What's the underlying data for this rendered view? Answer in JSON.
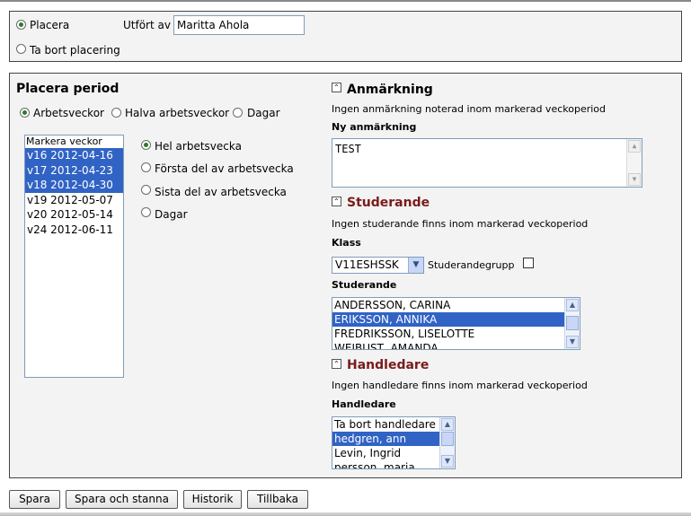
{
  "top": {
    "place_label": "Placera",
    "remove_label": "Ta bort placering",
    "performed_by_label": "Utfört av",
    "performed_by_value": "Maritta Ahola"
  },
  "period": {
    "title": "Placera period",
    "mode_options": [
      "Arbetsveckor",
      "Halva arbetsveckor",
      "Dagar"
    ],
    "mode_selected": "Arbetsveckor",
    "mark_weeks_label": "Markera veckor",
    "weeks": [
      {
        "label": "v16 2012-04-16",
        "selected": true
      },
      {
        "label": "v17 2012-04-23",
        "selected": true
      },
      {
        "label": "v18 2012-04-30",
        "selected": true
      },
      {
        "label": "v19 2012-05-07",
        "selected": false
      },
      {
        "label": "v20 2012-05-14",
        "selected": false
      },
      {
        "label": "v24 2012-06-11",
        "selected": false
      }
    ],
    "part_options": [
      "Hel arbetsvecka",
      "Första del av arbetsvecka",
      "Sista del av arbetsvecka",
      "Dagar"
    ],
    "part_selected": "Hel arbetsvecka"
  },
  "remark": {
    "title": "Anmärkning",
    "info": "Ingen anmärkning noterad inom markerad veckoperiod",
    "new_label": "Ny anmärkning",
    "new_value": "TEST"
  },
  "students": {
    "title": "Studerande",
    "info": "Ingen studerande finns inom markerad veckoperiod",
    "class_label": "Klass",
    "class_value": "V11ESHSSK",
    "group_label": "Studerandegrupp",
    "list_label": "Studerande",
    "list": [
      {
        "name": "ANDERSSON, CARINA",
        "selected": false
      },
      {
        "name": "ERIKSSON, ANNIKA",
        "selected": true
      },
      {
        "name": "FREDRIKSSON, LISELOTTE",
        "selected": false
      },
      {
        "name": "WEIBUST, AMANDA",
        "selected": false
      }
    ]
  },
  "supervisors": {
    "title": "Handledare",
    "info": "Ingen handledare finns inom markerad veckoperiod",
    "list_label": "Handledare",
    "list": [
      {
        "name": "Ta bort handledare",
        "selected": false
      },
      {
        "name": "hedgren, ann",
        "selected": true
      },
      {
        "name": "Levin, Ingrid",
        "selected": false
      },
      {
        "name": "persson, maria",
        "selected": false
      }
    ]
  },
  "buttons": {
    "save": "Spara",
    "save_stay": "Spara och stanna",
    "history": "Historik",
    "back": "Tillbaka"
  },
  "icons": {
    "collapse": "collapse-icon",
    "scroll_up": "arrow-up-icon",
    "scroll_down": "arrow-down-icon",
    "dropdown": "chevron-down-icon"
  }
}
